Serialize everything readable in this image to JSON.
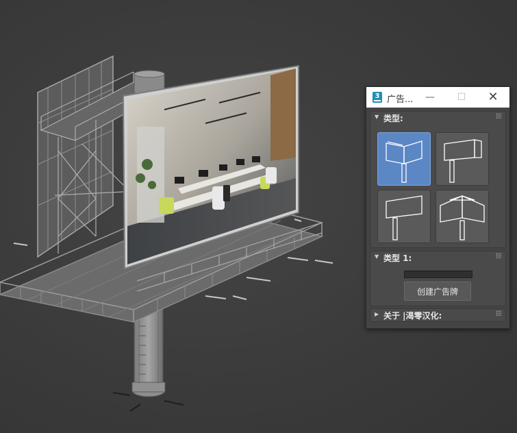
{
  "window": {
    "title": "广告...",
    "app_icon": "3ds-max-icon",
    "controls": {
      "minimize": "—",
      "maximize": "☐",
      "close": "✕"
    }
  },
  "rollouts": {
    "type": {
      "label": "类型:",
      "options": [
        {
          "icon": "angled-double-billboard-icon",
          "selected": true
        },
        {
          "icon": "single-panel-billboard-icon",
          "selected": false
        },
        {
          "icon": "flat-billboard-icon",
          "selected": false
        },
        {
          "icon": "v-shaped-billboard-icon",
          "selected": false
        }
      ]
    },
    "type1": {
      "label": "类型 1:",
      "progress": 0,
      "create_button": "创建广告牌"
    },
    "about": {
      "label": "关于 |渴零汉化:"
    }
  },
  "colors": {
    "viewport_bg": "#3a3a3a",
    "panel_bg": "#444444",
    "accent_selected": "#5b87c5",
    "titlebar_bg": "#ffffff"
  },
  "viewport": {
    "content": "3d-billboard-model-icon"
  }
}
